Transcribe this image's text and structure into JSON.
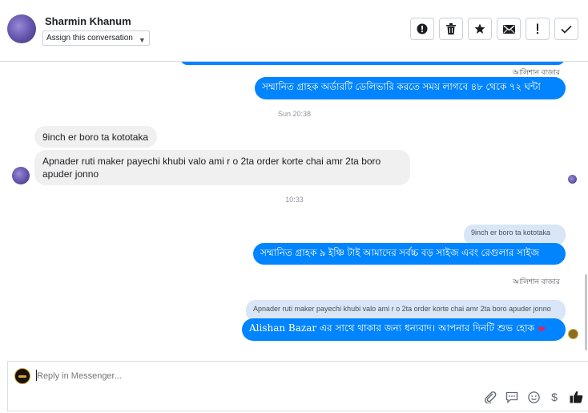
{
  "header": {
    "contact_name": "Sharmin Khanum",
    "assign_label": "Assign this conversation",
    "toolbar": [
      "spam-icon",
      "trash-icon",
      "star-icon",
      "mail-icon",
      "exclamation-icon",
      "check-icon"
    ]
  },
  "thread": {
    "top_sender": "আলিশান বাজার",
    "msg_out_1": "সম্মানিত গ্রাহক অর্ডারটি ডেলিভারি করতে সময় লাগবে ৪৮ থেকে ৭২ ঘন্টা",
    "time_1": "Sun 20:38",
    "msg_in_1": "9inch er boro ta kototaka",
    "msg_in_2": "Apnader ruti maker payechi khubi valo ami r o 2ta order korte chai amr 2ta boro apuder jonno",
    "time_2": "10:33",
    "quote_1": "9inch er boro ta kototaka",
    "msg_out_2": "সম্মানিত গ্রাহক ৯ ইঞ্চি টাই আমাদের সর্বচ্চ বড় সাইজ এবং রেগুলার সাইজ",
    "sender_2": "আলিশান বাজার",
    "quote_2": "Apnader ruti maker payechi khubi valo ami r o 2ta order korte chai amr 2ta boro apuder jonno",
    "msg_out_3": "Alishan Bazar এর সাথে থাকার জন্য ধন্যবাদ। আপনার দিনটি শুভ হোক",
    "heart": "❤"
  },
  "composer": {
    "placeholder": "Reply in Messenger...",
    "icons": [
      "attachment-icon",
      "saved-reply-icon",
      "emoji-icon",
      "dollar-icon",
      "like-icon"
    ]
  },
  "colors": {
    "messenger_blue": "#0084ff",
    "incoming_bubble": "#f1f0f0",
    "quote_bubble": "#d8e6f7"
  }
}
